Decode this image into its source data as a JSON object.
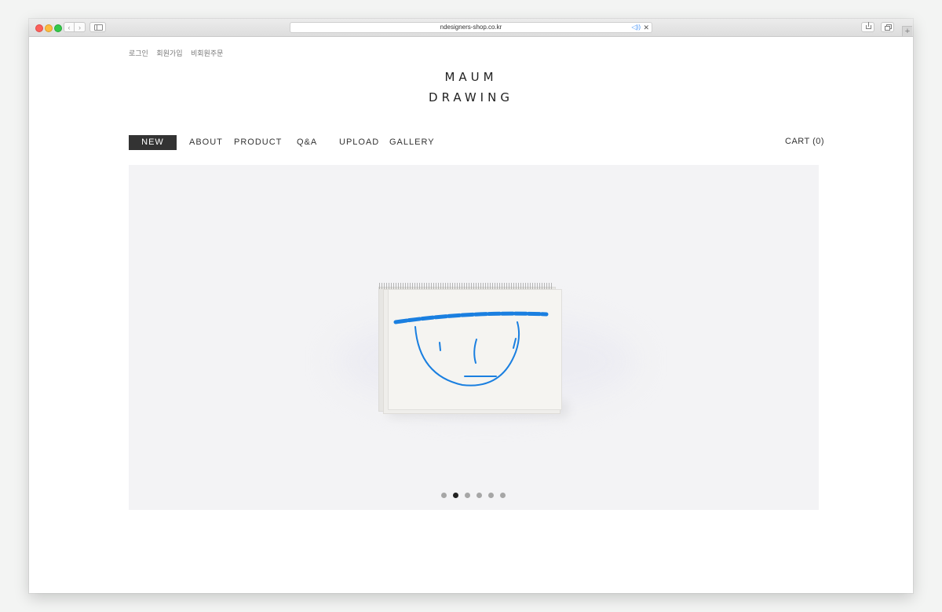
{
  "browser": {
    "url": "ndesigners-shop.co.kr",
    "speaker_glyph": "◁))",
    "close_glyph": "✕",
    "back_glyph": "‹",
    "forward_glyph": "›",
    "newtab_glyph": "+"
  },
  "util_links": [
    "로그인",
    "회원가입",
    "비회원주문"
  ],
  "logo": {
    "line1": "MAUM",
    "line2": "DRAWING"
  },
  "nav": [
    {
      "label": "NEW",
      "active": true
    },
    {
      "label": "ABOUT"
    },
    {
      "label": "PRODUCT"
    },
    {
      "label": "Q&A"
    },
    {
      "label": "UPLOAD"
    },
    {
      "label": "GALLERY"
    }
  ],
  "cart": {
    "label": "CART (0)"
  },
  "slider": {
    "count": 6,
    "active_index": 1
  },
  "colors": {
    "nav_active_bg": "#333333",
    "drawing_blue": "#1a7fe0",
    "hero_bg": "#f3f3f5"
  },
  "icons": [
    "sidebar-icon",
    "share-icon",
    "tabs-icon",
    "speaker-icon",
    "close-icon"
  ]
}
